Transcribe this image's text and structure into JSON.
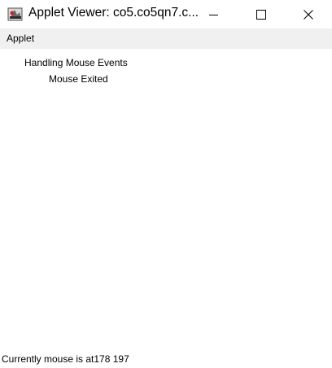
{
  "window": {
    "title": "Applet Viewer: co5.co5qn7.c...",
    "icon": "java-applet-icon",
    "controls": [
      "minimize-icon",
      "maximize-icon",
      "close-icon"
    ]
  },
  "menubar": {
    "items": [
      {
        "label": "Applet"
      }
    ]
  },
  "applet": {
    "line1": "Handling Mouse Events",
    "line2": "Mouse Exited"
  },
  "status": {
    "text": "Currently mouse is at178 197"
  }
}
